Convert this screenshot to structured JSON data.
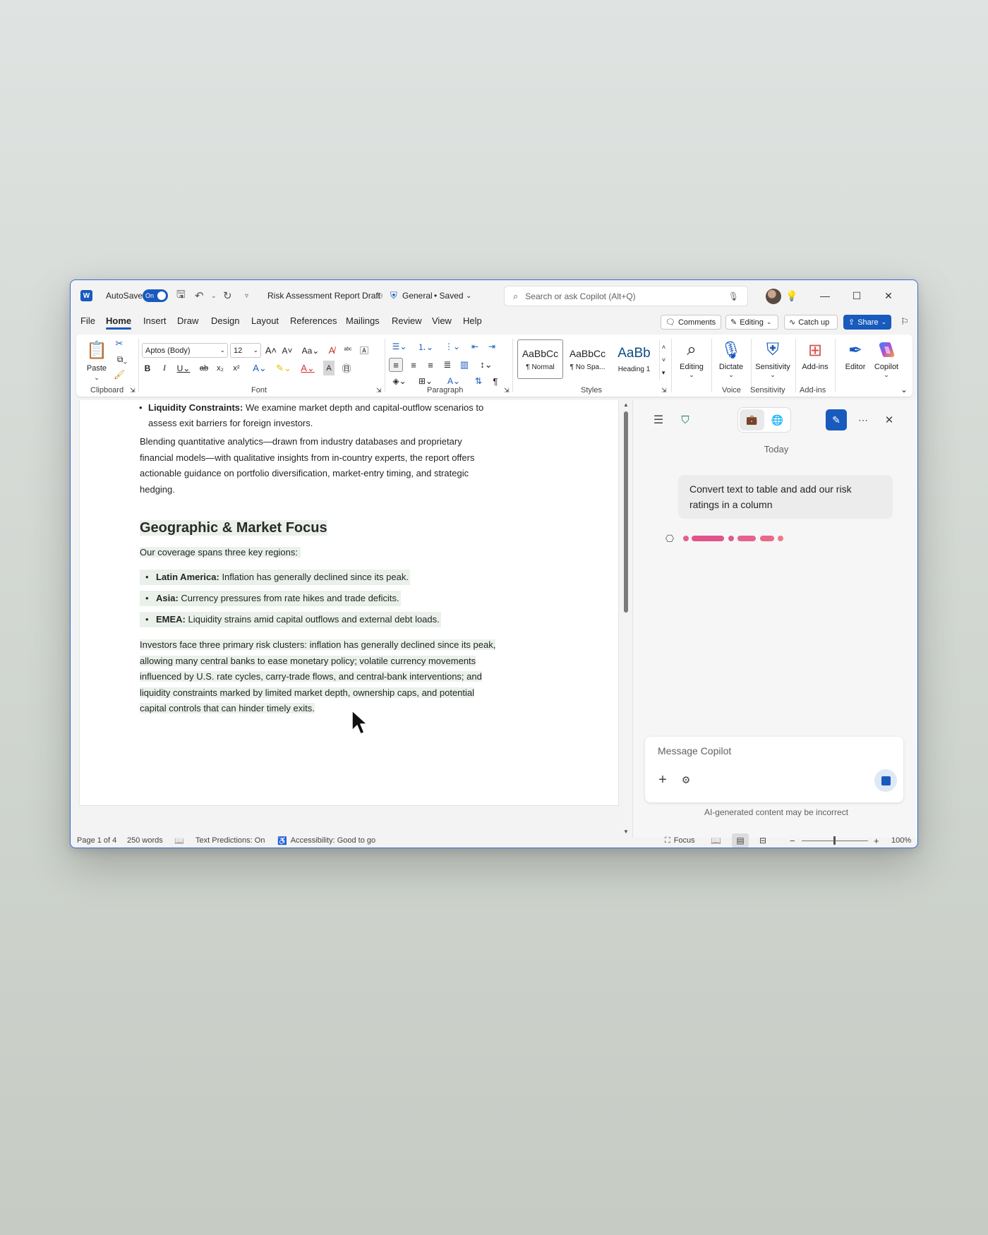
{
  "titlebar": {
    "autosave_label": "AutoSave",
    "autosave_state": "On",
    "doc_title": "Risk Assessment Report Draft",
    "sensitivity": "General",
    "save_status": "• Saved",
    "search_placeholder": "Search or ask Copilot (Alt+Q)"
  },
  "tabs": [
    "File",
    "Home",
    "Insert",
    "Draw",
    "Design",
    "Layout",
    "References",
    "Mailings",
    "Review",
    "View",
    "Help"
  ],
  "actions": {
    "comments": "Comments",
    "editing": "Editing",
    "catch_up": "Catch up",
    "share": "Share"
  },
  "ribbon": {
    "paste": "Paste",
    "clipboard": "Clipboard",
    "font_name": "Aptos (Body)",
    "font_size": "12",
    "font": "Font",
    "paragraph": "Paragraph",
    "styles": "Styles",
    "style_tiles": [
      {
        "preview": "AaBbCc",
        "name": "¶ Normal"
      },
      {
        "preview": "AaBbCc",
        "name": "¶ No Spa..."
      },
      {
        "preview": "AaBb",
        "name": "Heading 1"
      }
    ],
    "editing": "Editing",
    "dictate": "Dictate",
    "voice": "Voice",
    "sensitivity": "Sensitivity",
    "sensitivity_group": "Sensitivity",
    "addins": "Add-ins",
    "addins_group": "Add-ins",
    "editor": "Editor",
    "copilot": "Copilot"
  },
  "document": {
    "bullet_top_label": "Liquidity Constraints:",
    "bullet_top_text_1": " We examine market depth and capital-outflow scenarios to",
    "bullet_top_text_2": "assess exit barriers for foreign investors.",
    "para1": [
      "Blending quantitative analytics—drawn from industry databases and proprietary",
      "financial models—with qualitative insights from in-country experts, the report offers",
      "actionable guidance on portfolio diversification, market-entry timing, and strategic",
      "hedging."
    ],
    "heading": "Geographic & Market Focus",
    "intro": "Our coverage spans three key regions:",
    "regions": [
      {
        "label": "Latin America:",
        "text": " Inflation has generally declined since its peak."
      },
      {
        "label": "Asia:",
        "text": " Currency pressures from rate hikes and trade deficits."
      },
      {
        "label": "EMEA:",
        "text": " Liquidity strains amid capital outflows and external debt loads."
      }
    ],
    "para2": [
      "Investors face three primary risk clusters: inflation has generally declined since its peak,",
      "allowing many central banks to ease monetary policy; volatile currency movements",
      "influenced by U.S. rate cycles, carry-trade flows, and central-bank interventions; and",
      "liquidity constraints marked by limited market depth, ownership caps, and potential",
      "capital controls that can hinder timely exits."
    ]
  },
  "copilot": {
    "date_label": "Today",
    "user_message": "Convert text to table and add our risk ratings in a column",
    "input_placeholder": "Message Copilot",
    "disclaimer": "AI-generated content may be incorrect"
  },
  "statusbar": {
    "page": "Page 1 of 4",
    "words": "250 words",
    "predictions": "Text Predictions: On",
    "accessibility": "Accessibility: Good to go",
    "focus": "Focus",
    "zoom": "100%"
  },
  "colors": {
    "accent": "#185abd",
    "highlight": "#eaf1ea",
    "copilot_loader": "#e2628e"
  }
}
